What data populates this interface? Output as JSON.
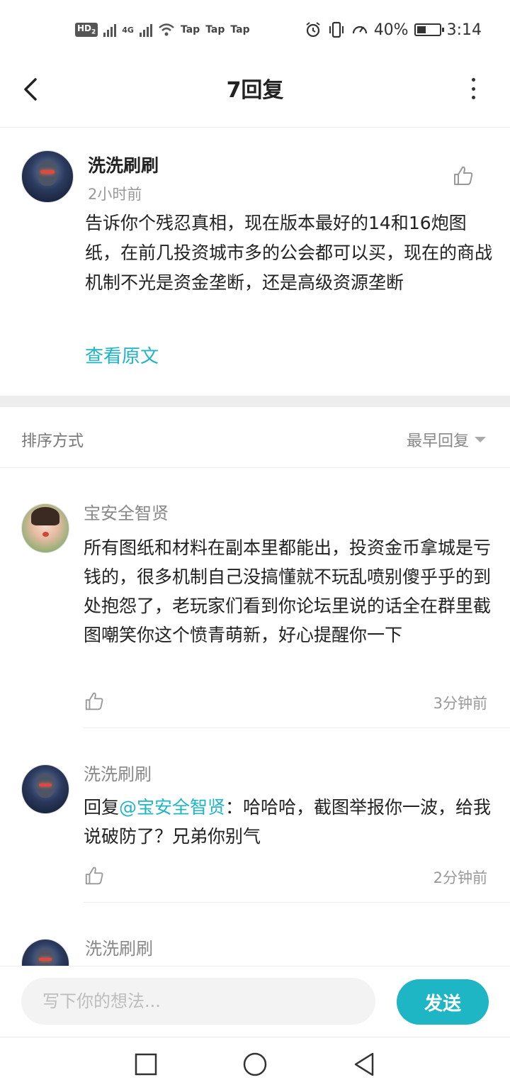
{
  "status_bar": {
    "hd": "HD",
    "hd_sub": "2",
    "network": "4G",
    "tap_labels": [
      "Tap",
      "Tap",
      "Tap"
    ],
    "battery_percent": "40%",
    "battery_level": 0.4,
    "time": "3:14"
  },
  "header": {
    "title": "7回复",
    "back_icon": "chevron-left-icon",
    "more_icon": "more-vertical-icon"
  },
  "post": {
    "author": "洗洗刷刷",
    "time": "2小时前",
    "body": "告诉你个残忍真相，现在版本最好的14和16炮图纸，在前几投资城市多的公会都可以买，现在的商战机制不光是资金垄断，还是高级资源垄断",
    "view_original": "查看原文"
  },
  "sort": {
    "label": "排序方式",
    "value": "最早回复"
  },
  "replies": [
    {
      "author": "宝安全智贤",
      "body": "所有图纸和材料在副本里都能出，投资金币拿城是亏钱的，很多机制自己没搞懂就不玩乱喷别傻乎乎的到处抱怨了，老玩家们看到你论坛里说的话全在群里截图嘲笑你这个愤青萌新，好心提醒你一下",
      "time": "3分钟前"
    },
    {
      "author": "洗洗刷刷",
      "reply_prefix": "回复",
      "mention": "@宝安全智贤",
      "body": "：哈哈哈，截图举报你一波，给我说破防了？兄弟你别气",
      "time": "2分钟前"
    },
    {
      "author": "洗洗刷刷"
    }
  ],
  "composer": {
    "placeholder": "写下你的想法...",
    "send_label": "发送"
  },
  "colors": {
    "accent": "#1eb5c4",
    "text": "#222222",
    "muted": "#999999"
  }
}
